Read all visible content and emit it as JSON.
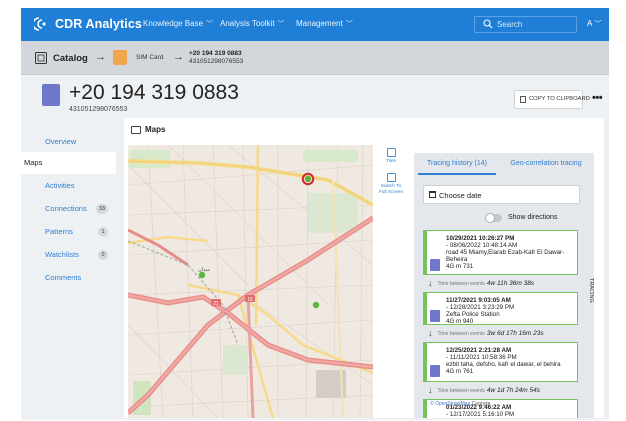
{
  "app": {
    "title": "CDR Analytics"
  },
  "nav": {
    "items": [
      "Knowledge Base",
      "Analysis Toolkit",
      "Management"
    ],
    "search_placeholder": "Search",
    "avatar": "A"
  },
  "breadcrumb": {
    "catalog": "Catalog",
    "sim": "SIM Card",
    "msisdn": "+20 194 319 0883",
    "imsi": "431051298076553"
  },
  "header": {
    "number": "+20 194 319 0883",
    "imsi": "431051298076553",
    "copy_label": "COPY TO CLIPBOARD",
    "more": "•••"
  },
  "sidebar": {
    "items": [
      {
        "label": "Overview"
      },
      {
        "label": "Maps"
      },
      {
        "label": "Activities"
      },
      {
        "label": "Connections",
        "badge": "33"
      },
      {
        "label": "Patterns",
        "badge": "1"
      },
      {
        "label": "Watchlists",
        "badge": "0"
      },
      {
        "label": "Comments"
      }
    ]
  },
  "maps": {
    "title": "Maps",
    "tools": [
      "Tiles",
      "Switch To Full Screen"
    ],
    "attribution_link": "© OpenStreetMap",
    "attribution_text": "Cognyte",
    "map_labels": [
      "ميدان",
      "21",
      "16"
    ]
  },
  "tracing": {
    "tabs": [
      "Tracing history (14)",
      "Geo-correlation tracing"
    ],
    "date_placeholder": "Choose date",
    "show_directions": "Show directions",
    "side_label": "TRACING",
    "gap_label": "Time between events",
    "events": [
      {
        "start": "10/29/2021 10:26:27 PM",
        "end": "- 08/06/2022 10:48:14 AM",
        "address": "road 45 Miamy,Elarab Ezab-Kafr El Dawar-Beheira",
        "tech": "4G m 731"
      },
      {
        "start": "11/27/2021 9:03:05 AM",
        "end": "- 12/28/2021 3:23:29 PM",
        "address": "Zefta Police Station",
        "tech": "4G m 940"
      },
      {
        "start": "12/25/2021 2:21:28 AM",
        "end": "- 11/11/2021 10:58:36 PM",
        "address": "ezbit taha, defsho, kafr el dawar, el behira",
        "tech": "4G m 761"
      },
      {
        "start": "01/23/2022 9:46:22 AM",
        "end": "- 12/17/2021 5:16:10 PM",
        "address": "",
        "tech": ""
      }
    ],
    "gaps": [
      "4w 11h 36m 38s",
      "3w 6d 17h 16m 23s",
      "4w 1d 7h 24m 54s"
    ]
  }
}
